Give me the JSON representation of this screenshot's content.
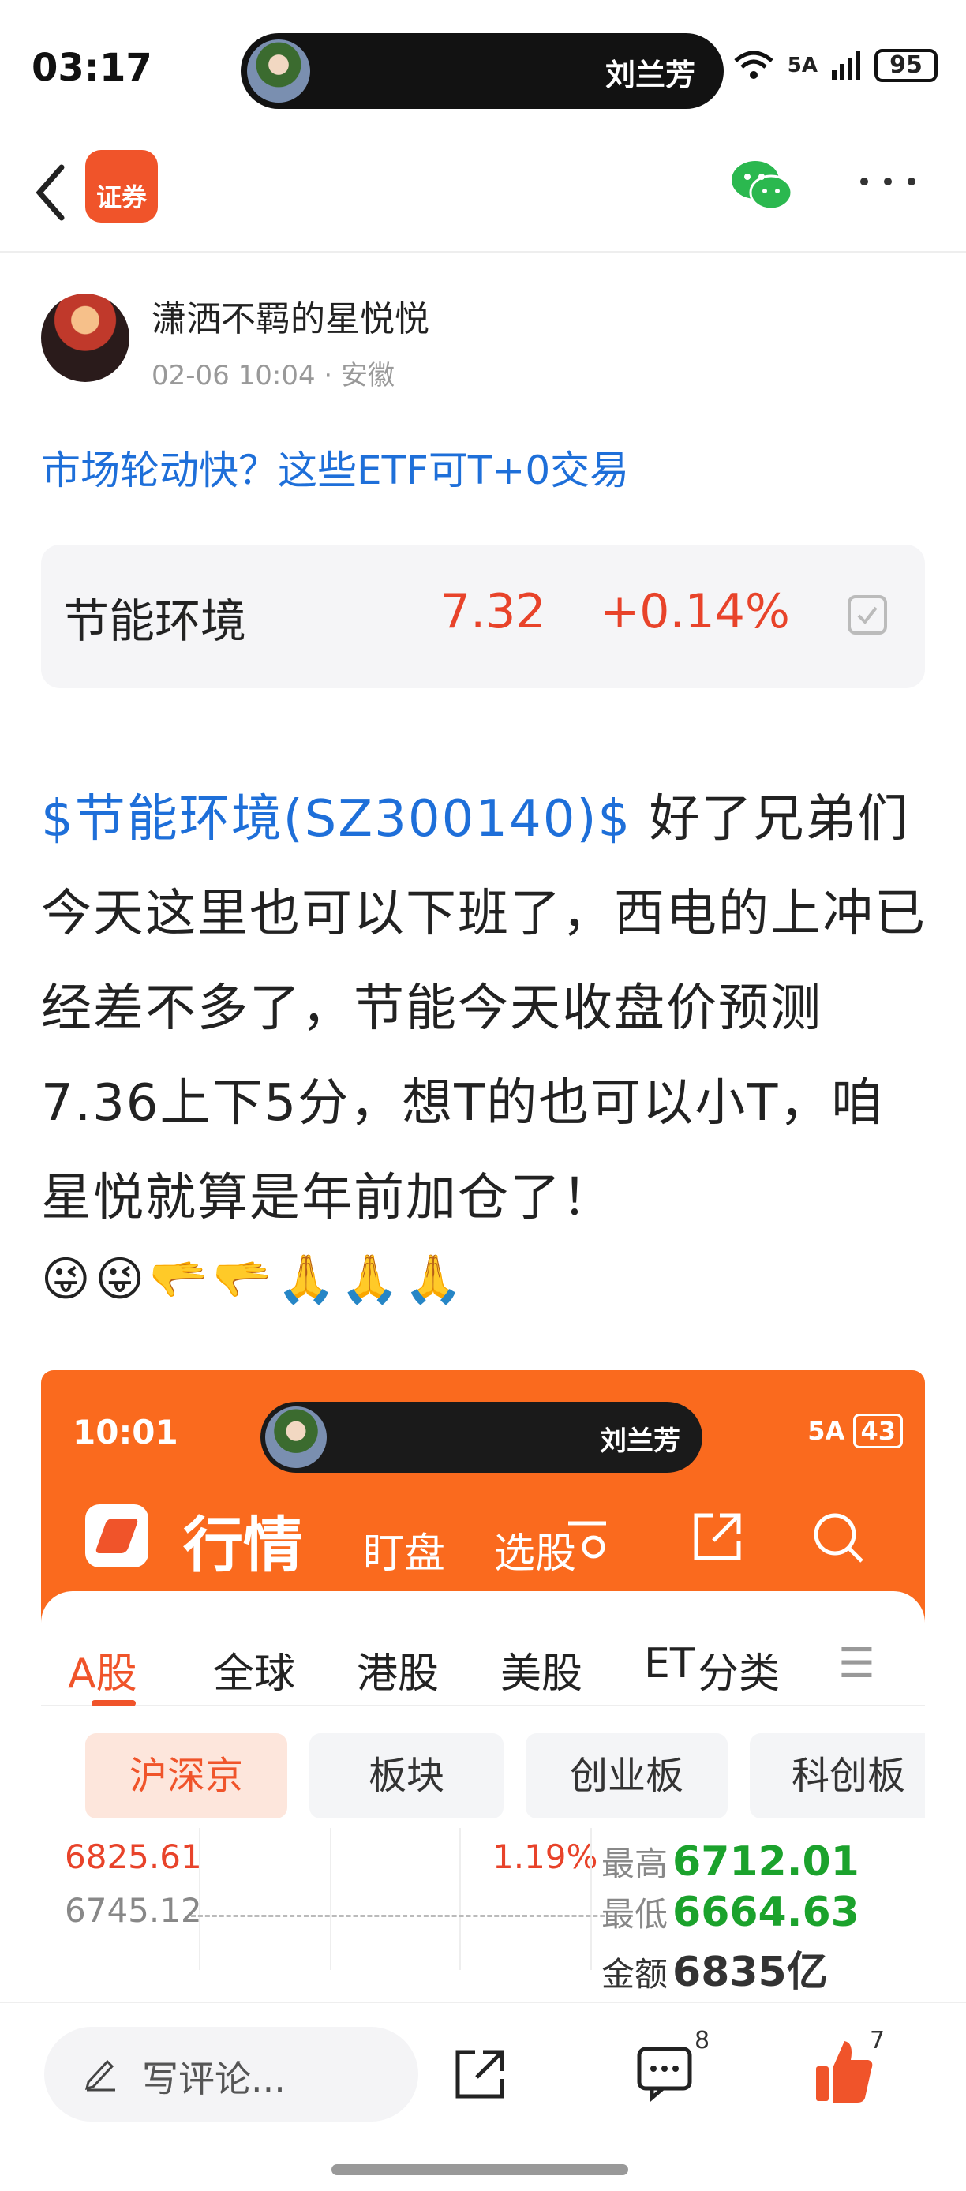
{
  "status": {
    "time": "03:17",
    "caller": "刘兰芳",
    "network": "5A",
    "battery": "95"
  },
  "nav": {
    "logo_text": "证券"
  },
  "post": {
    "author": "潇洒不羁的星悦悦",
    "meta": "02-06 10:04 · 安徽",
    "link": "市场轮动快？这些ETF可T+0交易",
    "stock": {
      "name": "节能环境",
      "price": "7.32",
      "change": "+0.14%"
    },
    "tag": "$节能环境(SZ300140)$",
    "body": " 好了兄弟们今天这里也可以下班了，西电的上冲已经差不多了，节能今天收盘价预测7.36上下5分，想T的也可以小T，咱星悦就算是年前加仓了！",
    "emojis": "😜😜🫳🫳🙏🙏🙏"
  },
  "embedded": {
    "time": "10:01",
    "caller": "刘兰芳",
    "network": "5A",
    "battery": "43",
    "title": "行情",
    "tab1": "盯盘",
    "tab2": "选股",
    "tabs": [
      "A股",
      "全球",
      "港股",
      "美股",
      "ET",
      "分类",
      "☰"
    ],
    "chips": [
      "沪深京",
      "板块",
      "创业板",
      "科创板"
    ],
    "levels": {
      "high": "6825.61",
      "mid": "6745.12",
      "pct": "1.19%"
    },
    "stats": [
      {
        "label": "最高",
        "value": "6712.01"
      },
      {
        "label": "最低",
        "value": "6664.63"
      },
      {
        "label": "金额",
        "value": "6835亿"
      }
    ]
  },
  "bottom": {
    "comment_placeholder": "写评论...",
    "comment_count": "8",
    "like_count": "7"
  }
}
